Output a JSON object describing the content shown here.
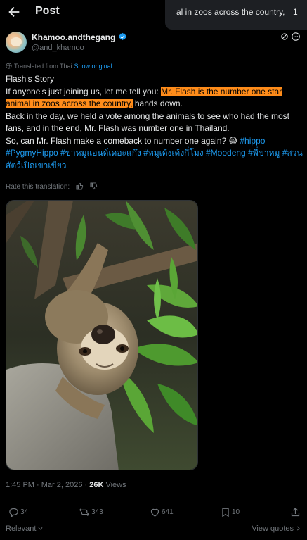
{
  "header": {
    "title": "Post"
  },
  "toast": {
    "text": "al in zoos across the country,",
    "index": "1"
  },
  "author": {
    "name": "Khamoo.andthegang",
    "handle": "@and_khamoo"
  },
  "translation": {
    "label": "Translated from Thai",
    "show_original": "Show original"
  },
  "tweet": {
    "title": "Flash's Story",
    "line2_prefix": "If anyone's just joining us, let me tell you: ",
    "highlight": "Mr. Flash is the number one star animal in zoos across the country,",
    "line2_suffix": " hands down.",
    "paragraph2": "Back in the day, we held a vote among the animals to see who had the most fans, and in the end, Mr. Flash was number one in Thailand.",
    "paragraph3": "So, can Mr. Flash make a comeback to number one again? ",
    "emoji": "😅",
    "hashtags": [
      "#hippo",
      "#PygmyHippo",
      "#ขาหมูแอนด์เดอะแก๊ง",
      "#หมูเด้งเด้งกี่โมง",
      "#Moodeng",
      "#พี่ขาหมู",
      "#สวนสัตว์เปิดเขาเขียว"
    ]
  },
  "rate": {
    "label": "Rate this translation:"
  },
  "media": {
    "alt": "sloth hanging upside down among green leaves"
  },
  "meta": {
    "time": "1:45 PM · Mar 2, 2026 · ",
    "views_count": "26K",
    "views_label": " Views"
  },
  "actions": {
    "replies": "34",
    "reposts": "343",
    "likes": "641",
    "bookmarks": "10"
  },
  "footer": {
    "sort": "Relevant",
    "view_quotes": "View quotes"
  },
  "colors": {
    "accent": "#1d9bf0",
    "highlight": "#ff8c1a",
    "muted": "#71767b"
  }
}
